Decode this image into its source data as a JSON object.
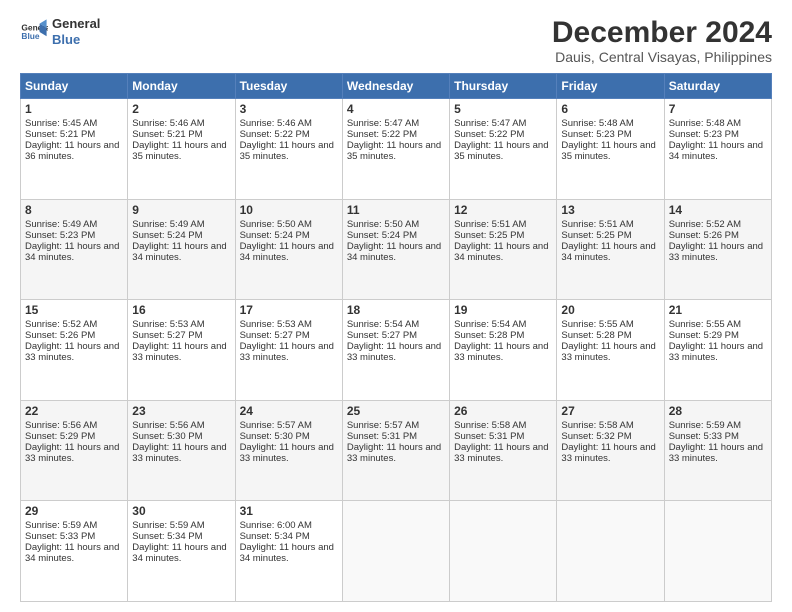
{
  "logo": {
    "line1": "General",
    "line2": "Blue"
  },
  "title": "December 2024",
  "subtitle": "Dauis, Central Visayas, Philippines",
  "header_days": [
    "Sunday",
    "Monday",
    "Tuesday",
    "Wednesday",
    "Thursday",
    "Friday",
    "Saturday"
  ],
  "weeks": [
    [
      {
        "day": 1,
        "sunrise": "5:45 AM",
        "sunset": "5:21 PM",
        "daylight": "11 hours and 36 minutes."
      },
      {
        "day": 2,
        "sunrise": "5:46 AM",
        "sunset": "5:21 PM",
        "daylight": "11 hours and 35 minutes."
      },
      {
        "day": 3,
        "sunrise": "5:46 AM",
        "sunset": "5:22 PM",
        "daylight": "11 hours and 35 minutes."
      },
      {
        "day": 4,
        "sunrise": "5:47 AM",
        "sunset": "5:22 PM",
        "daylight": "11 hours and 35 minutes."
      },
      {
        "day": 5,
        "sunrise": "5:47 AM",
        "sunset": "5:22 PM",
        "daylight": "11 hours and 35 minutes."
      },
      {
        "day": 6,
        "sunrise": "5:48 AM",
        "sunset": "5:23 PM",
        "daylight": "11 hours and 35 minutes."
      },
      {
        "day": 7,
        "sunrise": "5:48 AM",
        "sunset": "5:23 PM",
        "daylight": "11 hours and 34 minutes."
      }
    ],
    [
      {
        "day": 8,
        "sunrise": "5:49 AM",
        "sunset": "5:23 PM",
        "daylight": "11 hours and 34 minutes."
      },
      {
        "day": 9,
        "sunrise": "5:49 AM",
        "sunset": "5:24 PM",
        "daylight": "11 hours and 34 minutes."
      },
      {
        "day": 10,
        "sunrise": "5:50 AM",
        "sunset": "5:24 PM",
        "daylight": "11 hours and 34 minutes."
      },
      {
        "day": 11,
        "sunrise": "5:50 AM",
        "sunset": "5:24 PM",
        "daylight": "11 hours and 34 minutes."
      },
      {
        "day": 12,
        "sunrise": "5:51 AM",
        "sunset": "5:25 PM",
        "daylight": "11 hours and 34 minutes."
      },
      {
        "day": 13,
        "sunrise": "5:51 AM",
        "sunset": "5:25 PM",
        "daylight": "11 hours and 34 minutes."
      },
      {
        "day": 14,
        "sunrise": "5:52 AM",
        "sunset": "5:26 PM",
        "daylight": "11 hours and 33 minutes."
      }
    ],
    [
      {
        "day": 15,
        "sunrise": "5:52 AM",
        "sunset": "5:26 PM",
        "daylight": "11 hours and 33 minutes."
      },
      {
        "day": 16,
        "sunrise": "5:53 AM",
        "sunset": "5:27 PM",
        "daylight": "11 hours and 33 minutes."
      },
      {
        "day": 17,
        "sunrise": "5:53 AM",
        "sunset": "5:27 PM",
        "daylight": "11 hours and 33 minutes."
      },
      {
        "day": 18,
        "sunrise": "5:54 AM",
        "sunset": "5:27 PM",
        "daylight": "11 hours and 33 minutes."
      },
      {
        "day": 19,
        "sunrise": "5:54 AM",
        "sunset": "5:28 PM",
        "daylight": "11 hours and 33 minutes."
      },
      {
        "day": 20,
        "sunrise": "5:55 AM",
        "sunset": "5:28 PM",
        "daylight": "11 hours and 33 minutes."
      },
      {
        "day": 21,
        "sunrise": "5:55 AM",
        "sunset": "5:29 PM",
        "daylight": "11 hours and 33 minutes."
      }
    ],
    [
      {
        "day": 22,
        "sunrise": "5:56 AM",
        "sunset": "5:29 PM",
        "daylight": "11 hours and 33 minutes."
      },
      {
        "day": 23,
        "sunrise": "5:56 AM",
        "sunset": "5:30 PM",
        "daylight": "11 hours and 33 minutes."
      },
      {
        "day": 24,
        "sunrise": "5:57 AM",
        "sunset": "5:30 PM",
        "daylight": "11 hours and 33 minutes."
      },
      {
        "day": 25,
        "sunrise": "5:57 AM",
        "sunset": "5:31 PM",
        "daylight": "11 hours and 33 minutes."
      },
      {
        "day": 26,
        "sunrise": "5:58 AM",
        "sunset": "5:31 PM",
        "daylight": "11 hours and 33 minutes."
      },
      {
        "day": 27,
        "sunrise": "5:58 AM",
        "sunset": "5:32 PM",
        "daylight": "11 hours and 33 minutes."
      },
      {
        "day": 28,
        "sunrise": "5:59 AM",
        "sunset": "5:33 PM",
        "daylight": "11 hours and 33 minutes."
      }
    ],
    [
      {
        "day": 29,
        "sunrise": "5:59 AM",
        "sunset": "5:33 PM",
        "daylight": "11 hours and 34 minutes."
      },
      {
        "day": 30,
        "sunrise": "5:59 AM",
        "sunset": "5:34 PM",
        "daylight": "11 hours and 34 minutes."
      },
      {
        "day": 31,
        "sunrise": "6:00 AM",
        "sunset": "5:34 PM",
        "daylight": "11 hours and 34 minutes."
      },
      null,
      null,
      null,
      null
    ]
  ]
}
